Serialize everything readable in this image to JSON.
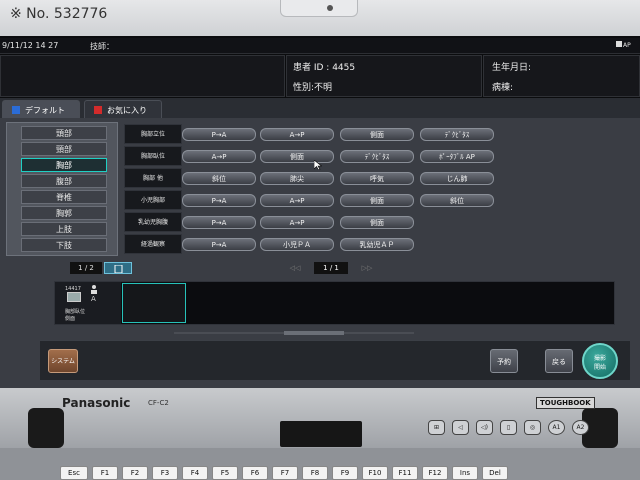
{
  "photo_label": "※ No. 532776",
  "header": {
    "datetime": "9/11/12 14 27",
    "technician_label": "技師：",
    "ap_badge": "AP",
    "patient_id": "患者 ID : 4455",
    "sex": "性別:不明",
    "birthdate_label": "生年月日:",
    "ward_label": "病棟:"
  },
  "tabs": [
    {
      "label": "デフォルト",
      "color": "#2b6cd6"
    },
    {
      "label": "お気に入り",
      "color": "#d32b2b"
    }
  ],
  "body_parts": [
    "頭部",
    "頸部",
    "胸部",
    "腹部",
    "脊椎",
    "胸郭",
    "上肢",
    "下肢"
  ],
  "selected_body_part": "胸部",
  "grid_rows": [
    {
      "label": "胸部立位",
      "buttons": [
        "P→A",
        "A→P",
        "側面",
        "ﾃﾞｸﾋﾞﾀｽ"
      ]
    },
    {
      "label": "胸部臥位",
      "buttons": [
        "A→P",
        "側面",
        "ﾃﾞｸﾋﾞﾀｽ",
        "ﾎﾟｰﾀﾌﾞﾙ AP"
      ]
    },
    {
      "label": "胸部 他",
      "buttons": [
        "斜位",
        "肺尖",
        "呼気",
        "じん肺"
      ]
    },
    {
      "label": "小児胸部",
      "buttons": [
        "P→A",
        "A→P",
        "側面",
        "斜位"
      ]
    },
    {
      "label": "乳幼児胸腹",
      "buttons": [
        "P→A",
        "A→P",
        "側面"
      ]
    },
    {
      "label": "経過観察",
      "buttons": [
        "P→A",
        "小児ＰＡ",
        "乳幼児ＡＰ"
      ]
    }
  ],
  "pager_left": "1 / 2",
  "pager_center": "1 / 1",
  "pager_prev": "◁◁",
  "pager_next": "▷▷",
  "series": {
    "number": "14417",
    "label": "A",
    "desc1": "胸部臥位",
    "desc2": "側面"
  },
  "bottom": {
    "system": "システム",
    "reserve": "予約",
    "back": "戻る",
    "start_line1": "撮影",
    "start_line2": "開始"
  },
  "bezel": {
    "brand": "Panasonic",
    "model": "CF-C2",
    "toughbook": "TOUGHBOOK",
    "hw_buttons": [
      "⊞",
      "◁",
      "◁)",
      "▯",
      "◎",
      "A1",
      "A2"
    ]
  },
  "keys": [
    "Esc",
    "F1",
    "F2",
    "F3",
    "F4",
    "F5",
    "F6",
    "F7",
    "F8",
    "F9",
    "F10",
    "F11",
    "F12",
    "Ins",
    "Del"
  ]
}
